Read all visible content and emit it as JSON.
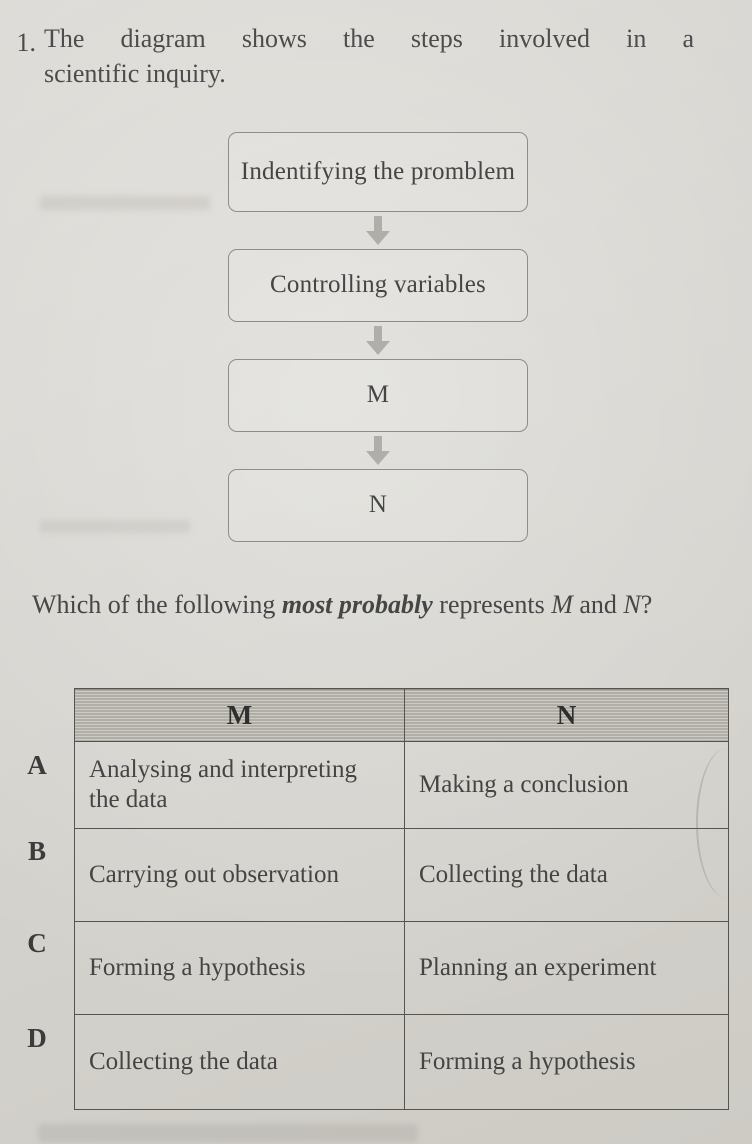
{
  "page": {
    "background_color": "#d8d6d1",
    "ink_color": "#444444"
  },
  "question": {
    "number": "1.",
    "stem_line1": "The diagram shows the steps involved in a",
    "stem_line2": "scientific inquiry.",
    "leadin_before": "Which of the following ",
    "leadin_emphasis": "most probably",
    "leadin_after": " represents ",
    "leadin_m": "M",
    "leadin_and": " and ",
    "leadin_n": "N",
    "leadin_end": "?"
  },
  "flowchart": {
    "arrow_icon": "down-arrow-icon",
    "steps": [
      {
        "id": "step-1",
        "label": "Indentifying the promblem"
      },
      {
        "id": "step-2",
        "label": "Controlling variables"
      },
      {
        "id": "step-3",
        "label": "M"
      },
      {
        "id": "step-4",
        "label": "N"
      }
    ]
  },
  "options_table": {
    "headers": {
      "blank": "",
      "m": "M",
      "n": "N"
    },
    "rows": [
      {
        "letter": "A",
        "m": "Analysing and interpreting the data",
        "n": "Making a conclusion"
      },
      {
        "letter": "B",
        "m": "Carrying out observation",
        "n": "Collecting the data"
      },
      {
        "letter": "C",
        "m": "Forming a hypothesis",
        "n": "Planning an experiment"
      },
      {
        "letter": "D",
        "m": "Collecting the data",
        "n": "Forming a hypothesis"
      }
    ]
  }
}
